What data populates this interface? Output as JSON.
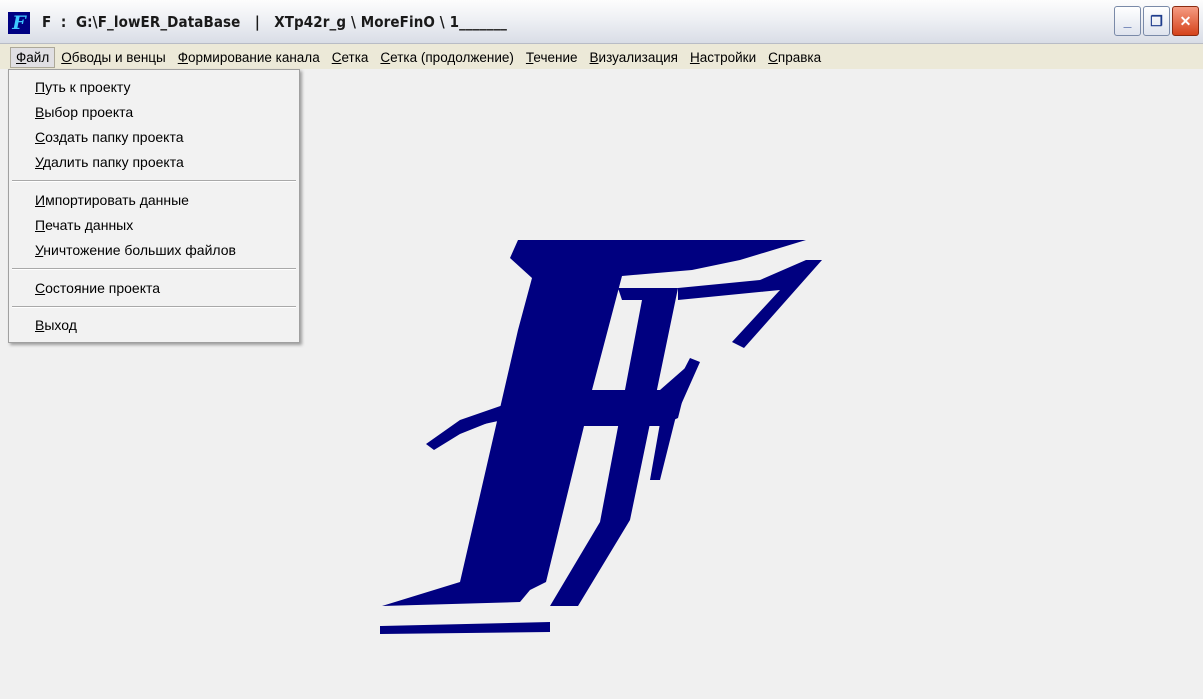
{
  "window": {
    "title": "F  :  G:\\F_lowER_DataBase   |   XTp42r_g \\ MoreFinO \\ 1_______",
    "app_icon_letter": "F",
    "controls": {
      "minimize": "_",
      "restore": "❐",
      "close": "✕"
    }
  },
  "menubar": {
    "items": [
      {
        "accel": "Ф",
        "rest": "айл"
      },
      {
        "accel": "О",
        "rest": "бводы и венцы"
      },
      {
        "accel": "Ф",
        "rest": "ормирование канала"
      },
      {
        "accel": "С",
        "rest": "етка"
      },
      {
        "accel": "С",
        "rest": "етка (продолжение)"
      },
      {
        "accel": "Т",
        "rest": "ечение"
      },
      {
        "accel": "В",
        "rest": "изуализация"
      },
      {
        "accel": "Н",
        "rest": "астройки"
      },
      {
        "accel": "С",
        "rest": "правка"
      }
    ]
  },
  "file_menu": {
    "items": [
      {
        "accel": "П",
        "rest": "уть к проекту"
      },
      {
        "accel": "В",
        "rest": "ыбор проекта"
      },
      {
        "accel": "С",
        "rest": "оздать папку проекта"
      },
      {
        "accel": "У",
        "rest": "далить папку проекта"
      },
      {
        "accel": "И",
        "rest": "мпортировать данные"
      },
      {
        "accel": "П",
        "rest": "ечать данных"
      },
      {
        "accel": "У",
        "rest": "ничтожение больших файлов"
      },
      {
        "accel": "С",
        "rest": "остояние проекта"
      },
      {
        "accel": "В",
        "rest": "ыход"
      }
    ]
  },
  "colors": {
    "logo": "#000080",
    "client_bg": "#f0f0f0",
    "menu_bg": "#ece9d8"
  }
}
